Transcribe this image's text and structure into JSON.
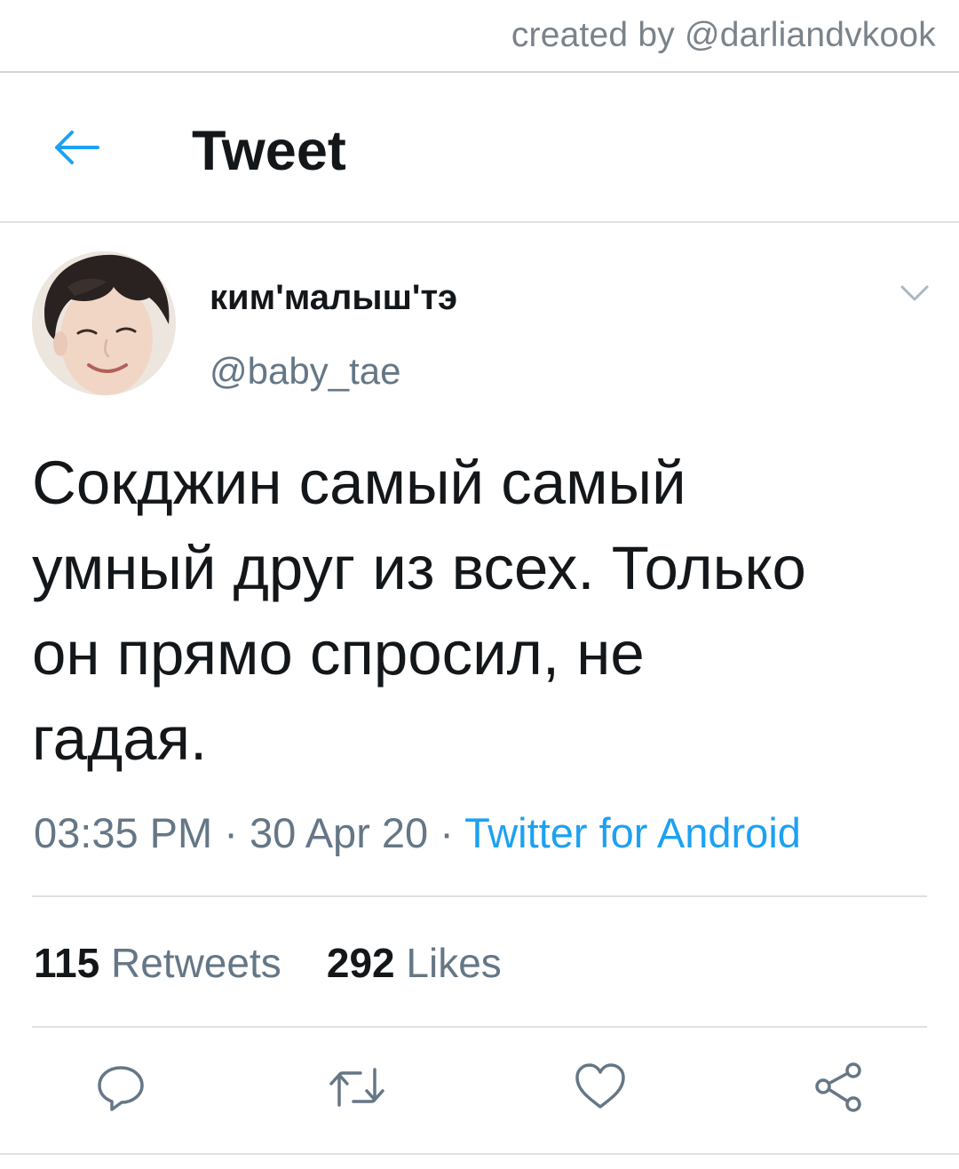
{
  "watermark": "created by @darliandvkook",
  "header": {
    "title": "Tweet",
    "back_icon": "arrow-left-icon"
  },
  "tweet": {
    "display_name": "ким'малыш'тэ",
    "handle": "@baby_tae",
    "text": "Сокджин самый самый\nумный друг из всех. Только\nон прямо спросил, не\nгадая.",
    "time": "03:35 PM",
    "separator": "·",
    "date": "30 Apr 20",
    "source": "Twitter for Android",
    "retweets_count": "115",
    "retweets_label": "Retweets",
    "likes_count": "292",
    "likes_label": "Likes"
  },
  "actions": [
    "reply-icon",
    "retweet-icon",
    "like-icon",
    "share-icon"
  ],
  "colors": {
    "accent": "#1da1f2",
    "muted_text": "#657786",
    "text": "#14171a",
    "divider": "#dde1e4"
  }
}
